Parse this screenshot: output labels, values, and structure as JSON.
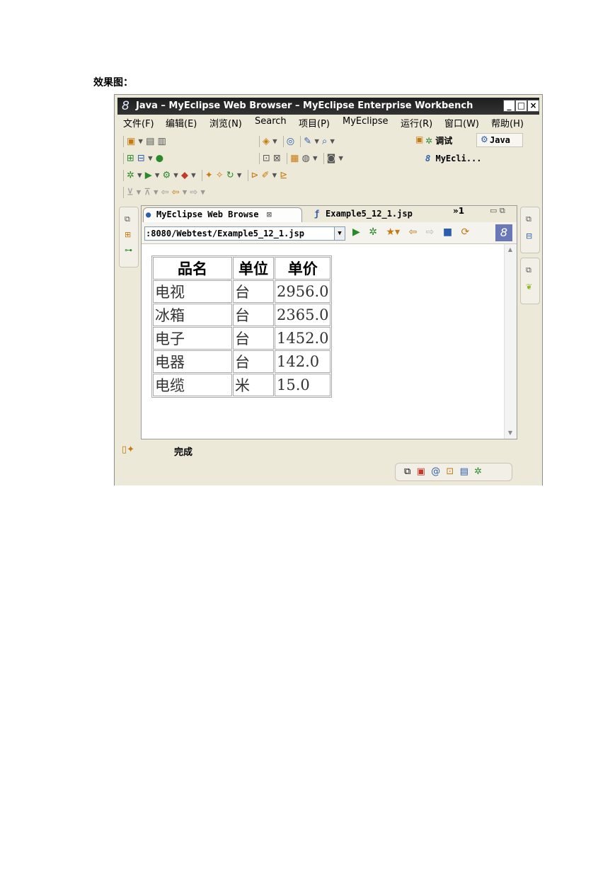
{
  "caption": "效果图：",
  "window": {
    "title": "Java – MyEclipse Web Browser – MyEclipse Enterprise Workbench",
    "controls": [
      "_",
      "□",
      "×"
    ]
  },
  "menu": [
    {
      "label": "文件(F)"
    },
    {
      "label": "编辑(E)"
    },
    {
      "label": "浏览(N)"
    },
    {
      "label": "Search"
    },
    {
      "label": "项目(P)"
    },
    {
      "label": "MyEclipse"
    },
    {
      "label": "运行(R)"
    },
    {
      "label": "窗口(W)"
    },
    {
      "label": "帮助(H)"
    }
  ],
  "perspectives": {
    "debug": "调试",
    "java": "Java",
    "myeclipse": "MyEcli..."
  },
  "editor": {
    "tabs": [
      {
        "label": "MyEclipse Web Browse",
        "icon": "globe-icon",
        "active": true
      },
      {
        "label": "Example5_12_1.jsp",
        "icon": "jsp-file-icon",
        "active": false
      }
    ],
    "more_tabs": "»1"
  },
  "browser": {
    "url": ":8080/Webtest/Example5_12_1.jsp"
  },
  "table": {
    "headers": [
      "品名",
      "单位",
      "单价"
    ],
    "rows": [
      [
        "电视",
        "台",
        "2956.0"
      ],
      [
        "冰箱",
        "台",
        "2365.0"
      ],
      [
        "电子",
        "台",
        "1452.0"
      ],
      [
        "电器",
        "台",
        "142.0"
      ],
      [
        "电缆",
        "米",
        "15.0"
      ]
    ]
  },
  "status": {
    "text": "完成"
  }
}
